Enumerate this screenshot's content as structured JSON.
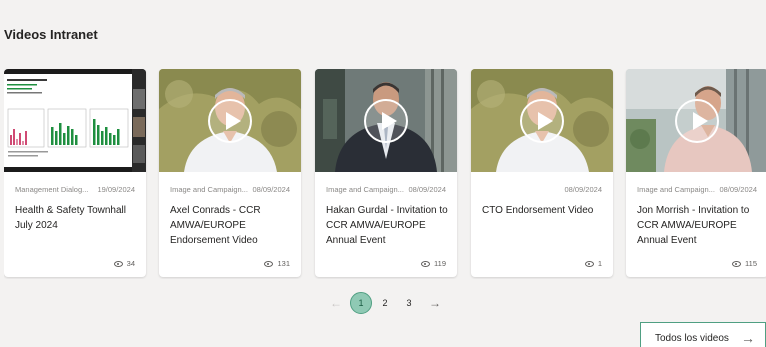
{
  "section": {
    "title": "Videos Intranet"
  },
  "videos": [
    {
      "category": "Management Dialog...",
      "date": "19/09/2024",
      "title": "Health & Safety Townhall July 2024",
      "views": "34",
      "has_play": false
    },
    {
      "category": "Image and Campaign...",
      "date": "08/09/2024",
      "title": "Axel Conrads - CCR AMWA/EUROPE Endorsement Video",
      "views": "131",
      "has_play": true
    },
    {
      "category": "Image and Campaign...",
      "date": "08/09/2024",
      "title": "Hakan Gurdal - Invitation to CCR AMWA/EUROPE Annual Event",
      "views": "119",
      "has_play": true
    },
    {
      "category": "",
      "date": "08/09/2024",
      "title": "CTO Endorsement Video",
      "views": "1",
      "has_play": true
    },
    {
      "category": "Image and Campaign...",
      "date": "08/09/2024",
      "title": "Jon Morrish - Invitation to CCR AMWA/EUROPE Annual Event",
      "views": "115",
      "has_play": true
    }
  ],
  "pagination": {
    "prev_icon": "arrow-left-icon",
    "pages": [
      "1",
      "2",
      "3"
    ],
    "active": "1",
    "next_icon": "arrow-right-icon"
  },
  "all_button": {
    "label": "Todos los videos",
    "icon": "arrow-right-icon"
  },
  "colors": {
    "accent": "#4f9f82",
    "active_page_bg": "#8fc9b4",
    "background": "#f3f2f1"
  }
}
